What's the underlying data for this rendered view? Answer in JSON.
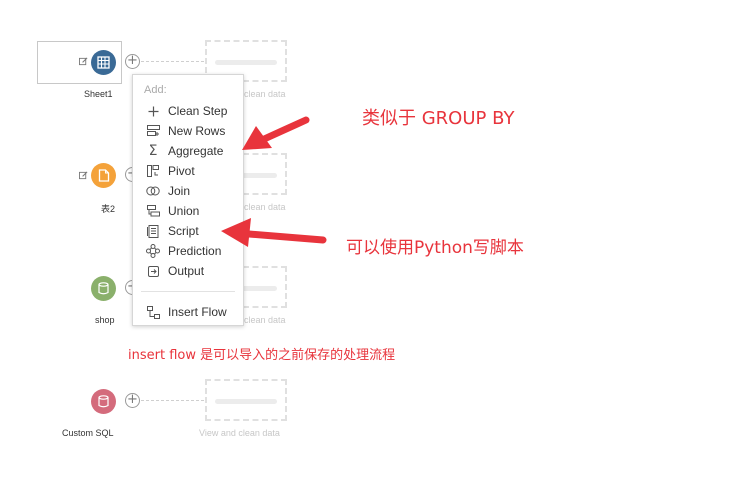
{
  "nodes": [
    {
      "label": "Sheet1",
      "type": "sheet"
    },
    {
      "label": "表2",
      "type": "file"
    },
    {
      "label": "shop",
      "type": "db"
    },
    {
      "label": "Custom SQL",
      "type": "sql"
    }
  ],
  "ghost": {
    "label": "View and clean data",
    "label_partial": "clean data"
  },
  "colors": {
    "sheet": "#3a6a96",
    "file": "#f4a23a",
    "db": "#8ab06b",
    "sql": "#d46b7c",
    "annotation": "#e8343c"
  },
  "menu": {
    "header": "Add:",
    "items": [
      {
        "label": "Clean Step",
        "icon": "plus-icon"
      },
      {
        "label": "New Rows",
        "icon": "new-rows-icon"
      },
      {
        "label": "Aggregate",
        "icon": "sigma-icon"
      },
      {
        "label": "Pivot",
        "icon": "pivot-icon"
      },
      {
        "label": "Join",
        "icon": "join-icon"
      },
      {
        "label": "Union",
        "icon": "union-icon"
      },
      {
        "label": "Script",
        "icon": "script-icon"
      },
      {
        "label": "Prediction",
        "icon": "prediction-icon"
      },
      {
        "label": "Output",
        "icon": "output-icon"
      }
    ],
    "insert_flow": {
      "label": "Insert Flow",
      "icon": "insert-flow-icon"
    }
  },
  "annotations": {
    "group_by": "类似于 GROUP BY",
    "script": "可以使用Python写脚本",
    "insert_flow": "insert flow 是可以导入的之前保存的处理流程"
  }
}
